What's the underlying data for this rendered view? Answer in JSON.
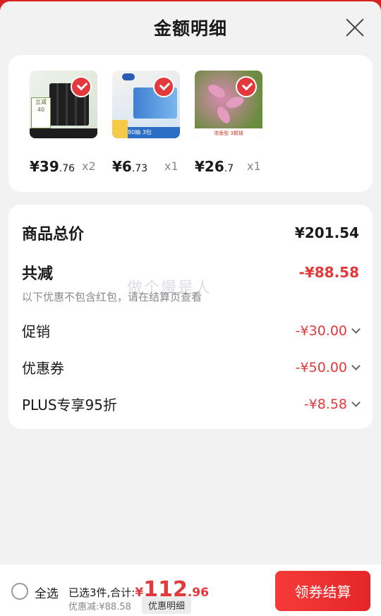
{
  "header": {
    "title": "金额明细"
  },
  "products": [
    {
      "price_int": "¥39",
      "price_dec": ".76",
      "qty": "x2",
      "thumb_badge": "立减40"
    },
    {
      "price_int": "¥6",
      "price_dec": ".73",
      "qty": "x1",
      "thumb_badge": "80抽 3包"
    },
    {
      "price_int": "¥26",
      "price_dec": ".7",
      "qty": "x1",
      "thumb_badge": "浓香型 3颗球"
    }
  ],
  "detail": {
    "total_label": "商品总价",
    "total_amount": "¥201.54",
    "reduce_label": "共减",
    "reduce_amount": "-¥88.58",
    "note": "以下优惠不包含红包，请在结算页查看",
    "items": [
      {
        "label": "促销",
        "amount": "-¥30.00"
      },
      {
        "label": "优惠券",
        "amount": "-¥50.00"
      },
      {
        "label": "PLUS专享95折",
        "amount": "-¥8.58"
      }
    ]
  },
  "watermark": "做个慢是人",
  "bottom": {
    "select_all": "全选",
    "selected_text": "已选3件,合计:",
    "total_yen": "¥",
    "total_int": "112",
    "total_dec": ".96",
    "discount_text": "优惠减:¥88.58",
    "discount_button": "优惠明细",
    "checkout": "领券结算"
  },
  "colors": {
    "accent": "#e4393c",
    "page_bg": "#f2f2f2"
  }
}
